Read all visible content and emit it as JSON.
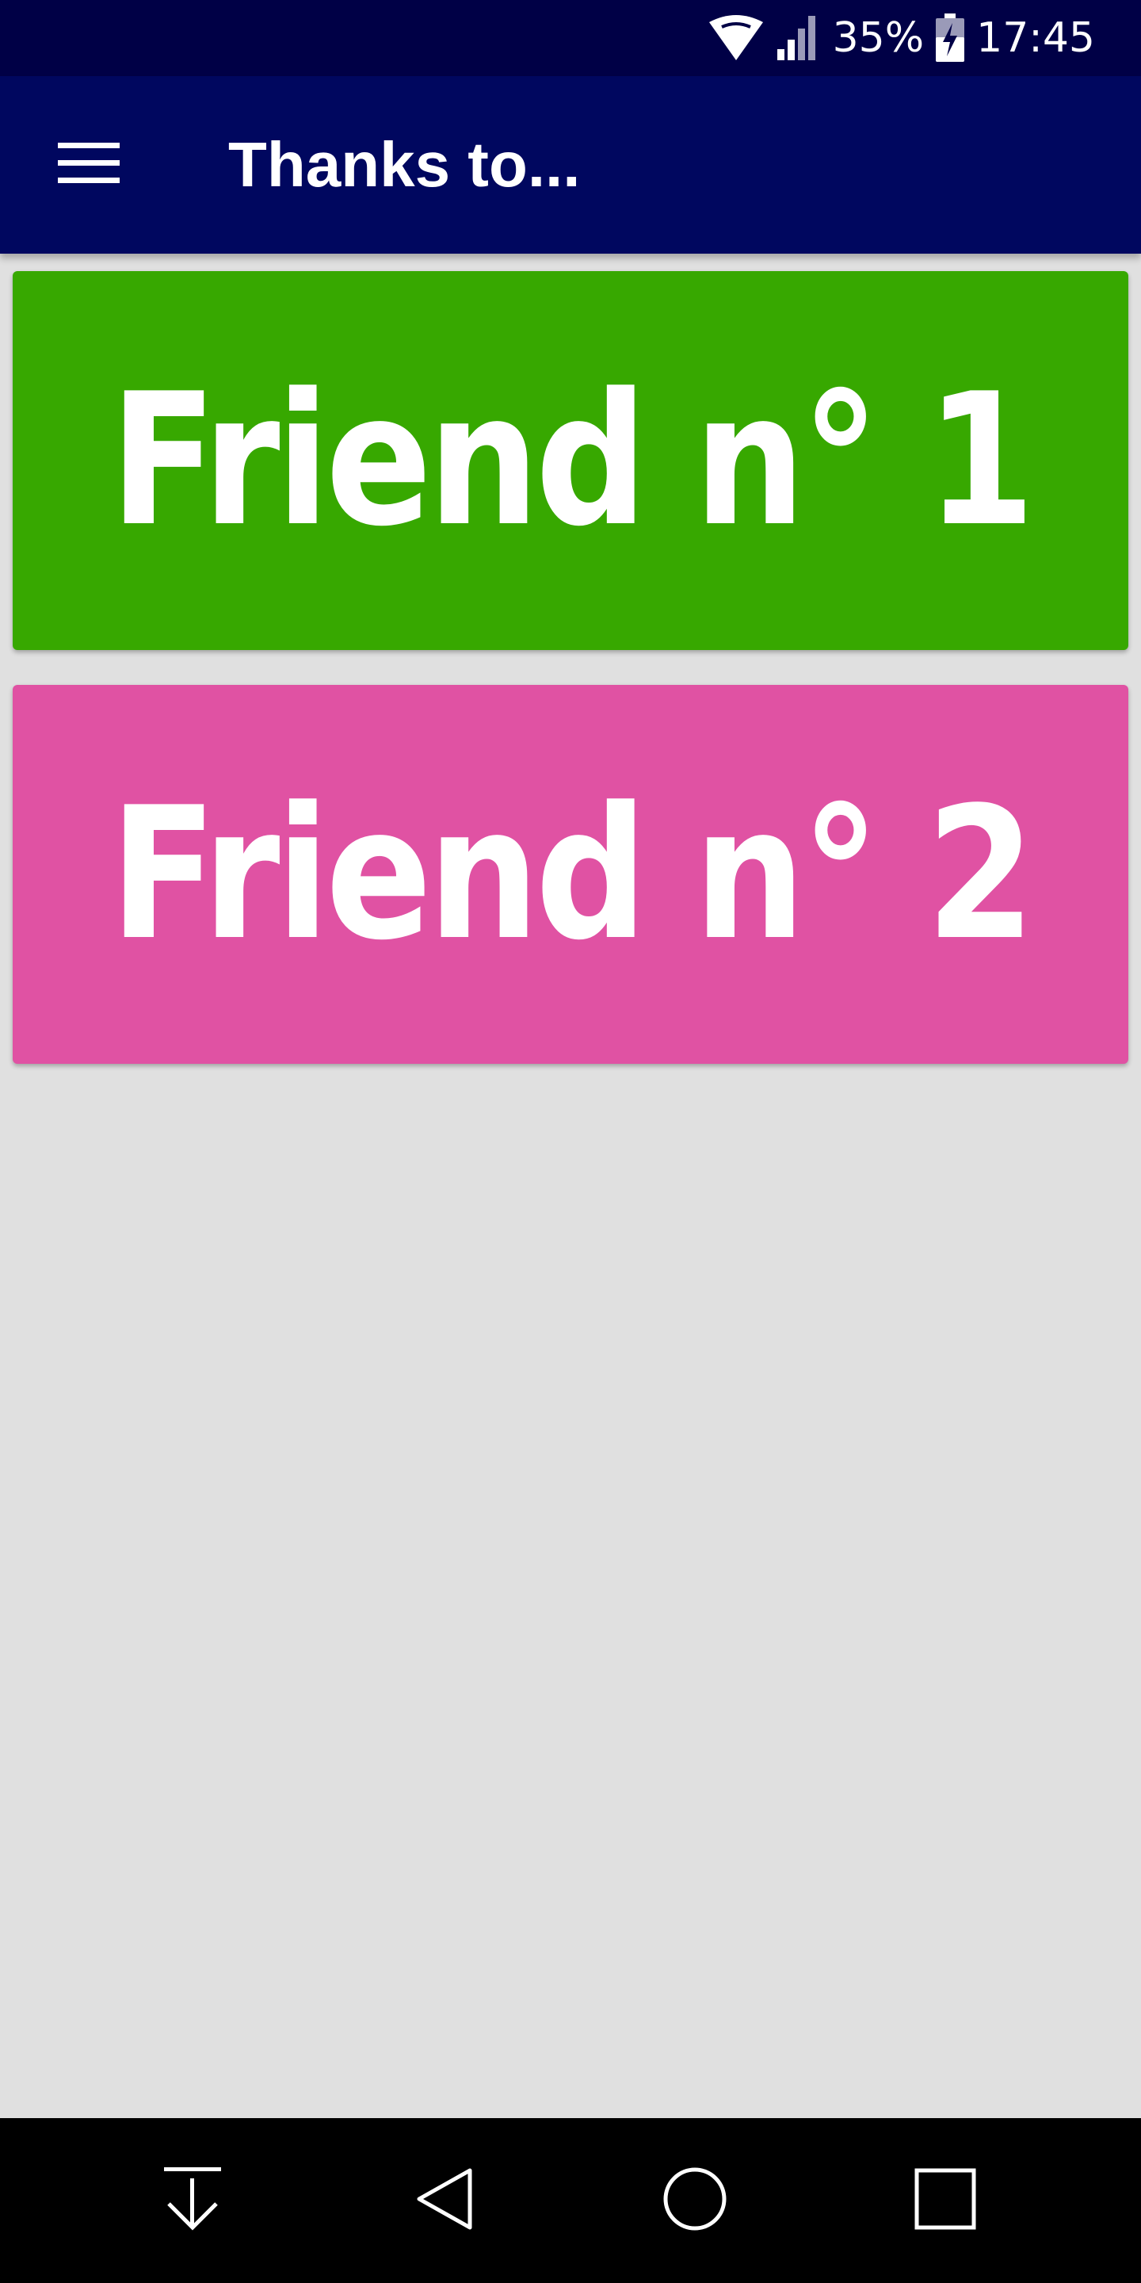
{
  "status_bar": {
    "battery_percent": "35%",
    "time": "17:45",
    "icons": [
      "wifi-icon",
      "signal-icon",
      "battery-charging-icon"
    ]
  },
  "app_bar": {
    "title": "Thanks to...",
    "menu_icon": "hamburger-menu-icon",
    "background_color": "#00075f"
  },
  "friends": [
    {
      "label": "Friend n° 1",
      "color": "#37a800"
    },
    {
      "label": "Friend n° 2",
      "color": "#e052a3"
    }
  ],
  "nav_bar": {
    "icons": [
      "download-arrow-icon",
      "back-triangle-icon",
      "home-circle-icon",
      "recent-apps-square-icon"
    ]
  }
}
